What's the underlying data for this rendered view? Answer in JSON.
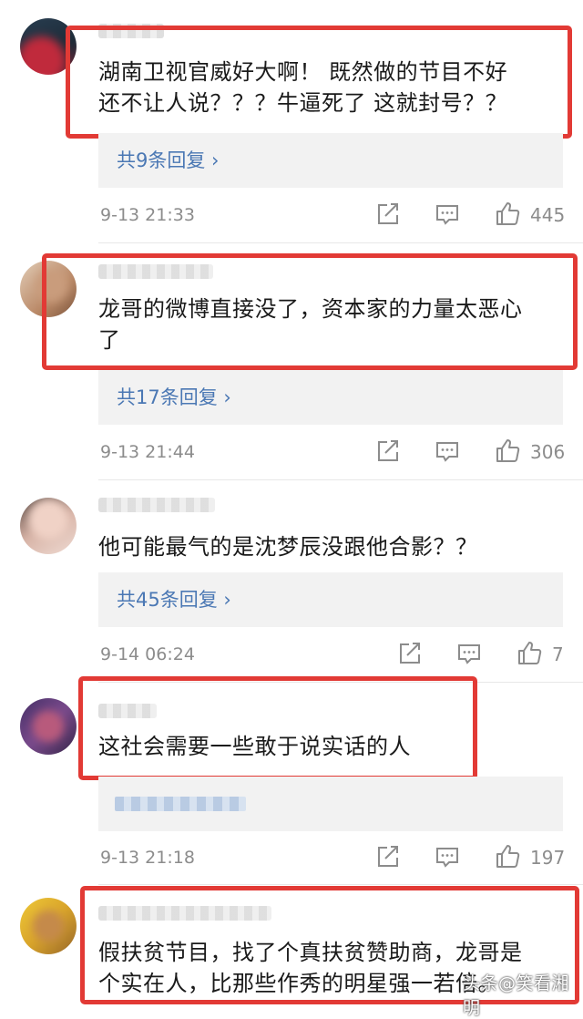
{
  "comments": [
    {
      "text_lines": [
        "湖南卫视官威好大啊！ 既然做的节目不好",
        "还不让人说？？？牛逼死了 这就封号？？"
      ],
      "reply_label": "共9条回复 ›",
      "time": "9-13 21:33",
      "likes": "445"
    },
    {
      "text_lines": [
        "龙哥的微博直接没了，资本家的力量太恶心",
        "了"
      ],
      "reply_label": "共17条回复 ›",
      "time": "9-13 21:44",
      "likes": "306"
    },
    {
      "text_lines": [
        "他可能最气的是沈梦辰没跟他合影？？"
      ],
      "reply_label": "共45条回复 ›",
      "time": "9-14 06:24",
      "likes": "7"
    },
    {
      "text_lines": [
        "这社会需要一些敢于说实话的人"
      ],
      "reply_label": "",
      "time": "9-13 21:18",
      "likes": "197"
    },
    {
      "text_lines": [
        "假扶贫节目，找了个真扶贫赞助商，龙哥是",
        "个实在人，比那些作秀的明星强一若倍。"
      ]
    }
  ],
  "icons": {
    "repost": "repost-icon",
    "comment": "comment-icon",
    "like": "like-icon"
  },
  "colors": {
    "highlight": "#e23a35",
    "link": "#4b78b4",
    "meta": "#8c8c8c"
  },
  "watermark": "头条@笑看湘明"
}
